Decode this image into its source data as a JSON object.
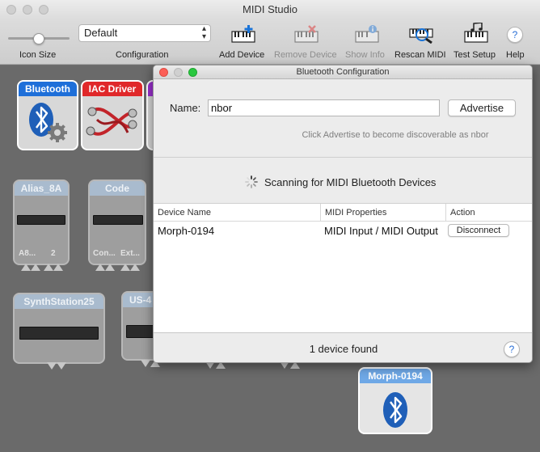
{
  "window": {
    "title": "MIDI Studio"
  },
  "toolbar": {
    "icon_size_label": "Icon Size",
    "configuration_label": "Configuration",
    "configuration_value": "Default",
    "add_device": "Add Device",
    "remove_device": "Remove Device",
    "show_info": "Show Info",
    "rescan_midi": "Rescan MIDI",
    "test_setup": "Test Setup",
    "help": "Help",
    "help_glyph": "?",
    "icon_size_level": 0.5
  },
  "devices": {
    "bluetooth": "Bluetooth",
    "iac_driver": "IAC Driver",
    "alias_8a": "Alias_8A",
    "alias_ports": [
      "A8...",
      "2"
    ],
    "code": "Code",
    "code_ports": [
      "Con...",
      "Ext..."
    ],
    "synthstation25": "SynthStation25",
    "us_4": "US-4",
    "morph": "Morph-0194"
  },
  "panel": {
    "title": "Bluetooth Configuration",
    "name_label": "Name:",
    "name_value": "nbor",
    "advertise_button": "Advertise",
    "hint": "Click Advertise to become discoverable as nbor",
    "scanning": "Scanning for MIDI Bluetooth Devices",
    "columns": [
      "Device Name",
      "MIDI Properties",
      "Action"
    ],
    "rows": [
      {
        "name": "Morph-0194",
        "props": "MIDI Input / MIDI Output",
        "action": "Disconnect"
      }
    ],
    "footer": "1 device found",
    "help_glyph": "?"
  },
  "colors": {
    "bluetooth_header": "#1e6fd9",
    "iac_header": "#e0282a",
    "purple_header": "#9b30d0",
    "bluetooth_blue": "#1f5fb8"
  }
}
